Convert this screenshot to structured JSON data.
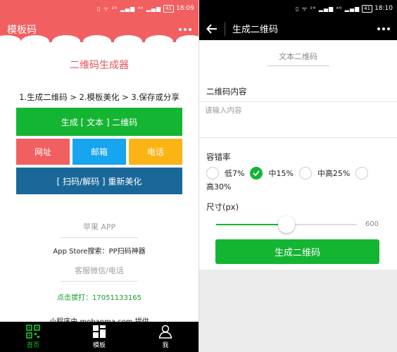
{
  "left": {
    "status_time": "18:09",
    "status_icons": "▯ ᯤ ²⁶ ▂▄▆ ⁴⁶ ▂▄▆",
    "battery": "41",
    "header_title": "模板码",
    "page_title": "二维码生成器",
    "steps": "1.生成二维码 > 2.模板美化 > 3.保存或分享",
    "btn_generate_text": "生成 [ 文本 ] 二维码",
    "btn_url": "网址",
    "btn_email": "邮箱",
    "btn_phone": "电话",
    "btn_rescan": "[ 扫码/解码 ] 重新美化",
    "apple_app": "苹果 APP",
    "appstore_search": "App Store搜索：PP扫码神器",
    "service_contact": "客服微信/电话",
    "dial_number": "点击拔打：17051133165",
    "mini_program": "小程序由 mobanma.com 提供",
    "tabs": [
      {
        "label": "首页",
        "icon": "qrcode-icon",
        "active": true
      },
      {
        "label": "模板",
        "icon": "grid-icon",
        "active": false
      },
      {
        "label": "我",
        "icon": "user-icon",
        "active": false
      }
    ]
  },
  "right": {
    "status_time": "18:10",
    "status_icons": "▯ ᯤ ²⁶ ▂▄▆ ⁴⁶ ▂▄▆",
    "battery": "41",
    "header_title": "生成二维码",
    "mode_tab": "文本二维码",
    "content_label": "二维码内容",
    "content_placeholder": "请输入内容",
    "ec_label": "容错率",
    "ec_options": [
      {
        "label": "低7%",
        "checked": false
      },
      {
        "label": "中15%",
        "checked": true
      },
      {
        "label": "中高25%",
        "checked": false
      },
      {
        "label": "高30%",
        "checked": false
      }
    ],
    "size_label": "尺寸(px)",
    "size_value": "600",
    "size_fraction": 0.5,
    "generate_button": "生成二维码"
  },
  "colors": {
    "brand_red": "#f25f61",
    "green": "#14b532",
    "blue": "#16a5ee",
    "yellow": "#fbb415",
    "navy": "#1a6899"
  }
}
